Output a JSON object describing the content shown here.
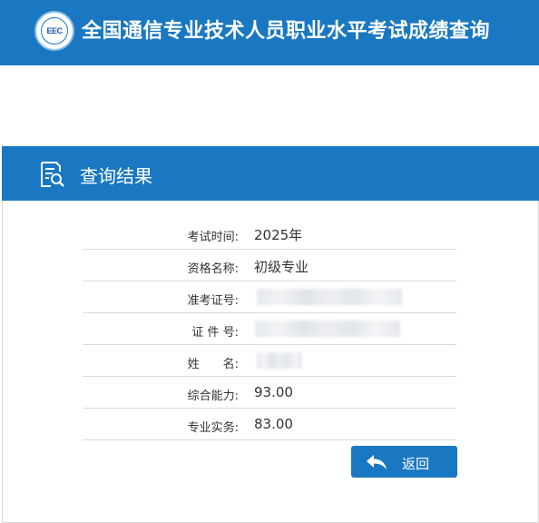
{
  "header": {
    "logo_text": "EEC",
    "title": "全国通信专业技术人员职业水平考试成绩查询"
  },
  "panel": {
    "title": "查询结果"
  },
  "results": [
    {
      "label": "考试时间:",
      "value": "2025年"
    },
    {
      "label": "资格名称:",
      "value": "初级专业"
    },
    {
      "label": "准考证号:",
      "value": ""
    },
    {
      "label": "证 件 号:",
      "value": ""
    },
    {
      "label": "姓　　名:",
      "value": ""
    },
    {
      "label": "综合能力:",
      "value": "93.00"
    },
    {
      "label": "专业实务:",
      "value": "83.00"
    }
  ],
  "back_button": {
    "label": "返回",
    "icon": "back-arrow-icon"
  },
  "colors": {
    "primary": "#1a78c2",
    "text": "#333333",
    "divider": "#dcdcdc"
  }
}
